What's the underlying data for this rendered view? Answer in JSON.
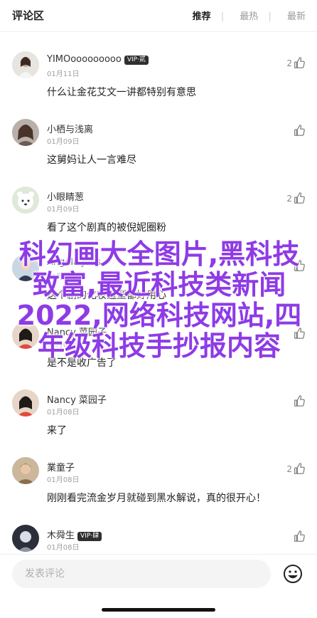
{
  "header": {
    "title": "评论区",
    "tabs": [
      {
        "label": "推荐",
        "active": true
      },
      {
        "label": "最热",
        "active": false
      },
      {
        "label": "最新",
        "active": false
      }
    ]
  },
  "comments": [
    {
      "name": "YIMOooooooooo",
      "vip": "VIP·贰",
      "date": "01月11日",
      "text": "什么让金花艾文一讲都特别有意思",
      "likes": "2"
    },
    {
      "name": "小栖与浅离",
      "vip": "",
      "date": "01月09日",
      "text": "这舅妈让人一言难尽",
      "likes": ""
    },
    {
      "name": "小眼睛葱",
      "vip": "",
      "date": "01月09日",
      "text": "看了这个剧真的被倪妮圈粉",
      "likes": "2"
    },
    {
      "name": "Angela Jobs",
      "vip": "",
      "date": "01月09日",
      "text": "这个剧的化妆造型都好用心",
      "likes": ""
    },
    {
      "name": "Nancy 菜园子",
      "vip": "",
      "date": "01月08日",
      "text": "是不是收广告了",
      "likes": ""
    },
    {
      "name": "Nancy 菜园子",
      "vip": "",
      "date": "01月08日",
      "text": "来了",
      "likes": ""
    },
    {
      "name": "業童子",
      "vip": "",
      "date": "01月08日",
      "text": "刚刚看完流金岁月就碰到黑水解说，真的很开心！",
      "likes": "2"
    },
    {
      "name": "木舜生",
      "vip": "VIP·肆",
      "date": "01月08日",
      "text": "",
      "likes": ""
    }
  ],
  "overlay_text": "科幻画大全图片,黑科技致富,最近科技类新闻2022,网络科技网站,四年级科技手抄报内容",
  "input": {
    "placeholder": "发表评论"
  },
  "icons": {
    "like": "thumbs-up-icon",
    "emoji": "smiley-icon"
  },
  "colors": {
    "overlay": "#8e3be6",
    "vip_badge": "#2f2f2f",
    "meta": "#a0a0a0"
  }
}
